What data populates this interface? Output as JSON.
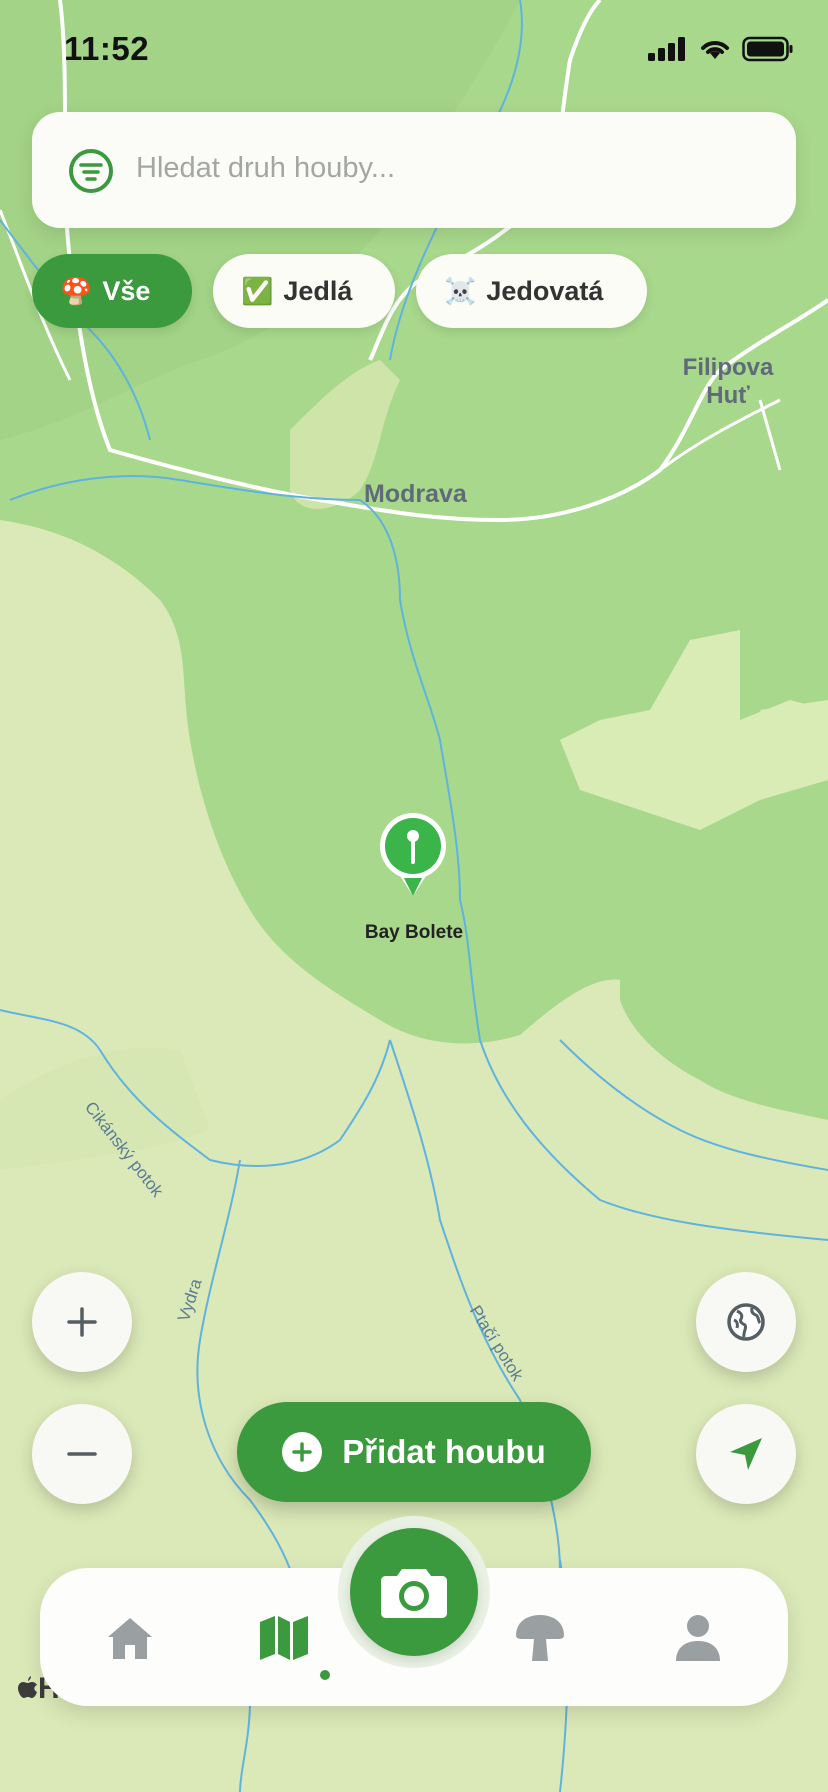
{
  "status": {
    "time": "11:52"
  },
  "search": {
    "placeholder": "Hledat druh houby..."
  },
  "filters": [
    {
      "emoji": "🍄",
      "label": "Vše",
      "active": true
    },
    {
      "emoji": "✅",
      "label": "Jedlá",
      "active": false
    },
    {
      "emoji": "☠️",
      "label": "Jedovatá",
      "active": false
    }
  ],
  "map": {
    "places": {
      "modrava": "Modrava",
      "filipova_line1": "Filipova",
      "filipova_line2": "Huť"
    },
    "streams": {
      "cikansky": "Cikánský potok",
      "vydra": "Vydra",
      "ptaci": "Ptačí potok"
    },
    "pin": {
      "label": "Bay Bolete",
      "color": "#3bb44a"
    }
  },
  "add_button": {
    "label": "Přidat houbu"
  },
  "colors": {
    "accent": "#3b9a3d",
    "forest": "#a8d88c",
    "meadow": "#dbe9b8",
    "water": "#5fb3de"
  },
  "tabbar": {
    "tabs": [
      "home-icon",
      "map-icon",
      "camera-icon",
      "mushroom-icon",
      "profile-icon"
    ],
    "active": "map-icon"
  },
  "legal": {
    "text": "Ho"
  }
}
